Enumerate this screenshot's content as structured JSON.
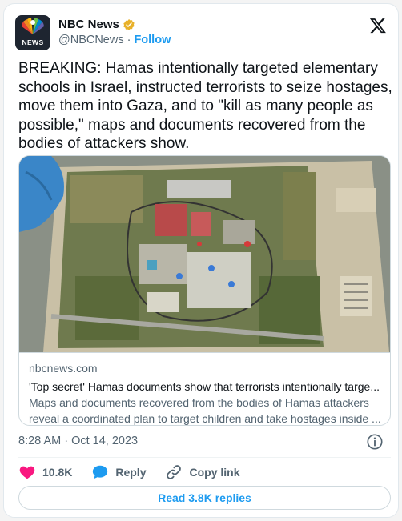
{
  "author": {
    "name": "NBC News",
    "handle": "@NBCNews",
    "separator": "·",
    "follow_label": "Follow",
    "avatar_text": "NEWS",
    "verified_badge_color": "#e8b12a"
  },
  "tweet": {
    "text": "BREAKING: Hamas intentionally targeted elementary schools in Israel, instructed terrorists to seize hostages, move them into Gaza, and to \"kill as many people as possible,\" maps and documents recovered from the bodies of attackers show.",
    "timestamp": "8:28 AM · Oct 14, 2023"
  },
  "link_card": {
    "domain": "nbcnews.com",
    "title": "'Top secret' Hamas documents show that terrorists intentionally targe...",
    "description_line1": "Maps and documents recovered from the bodies of Hamas attackers",
    "description_line2": "reveal a coordinated plan to target children and take hostages inside ...",
    "image_alt": "aerial map photo"
  },
  "actions": {
    "like_count": "10.8K",
    "reply_label": "Reply",
    "copy_link_label": "Copy link",
    "read_replies_label": "Read 3.8K replies"
  },
  "colors": {
    "accent": "#1d9bf0",
    "like": "#f91880",
    "text": "#0f1419",
    "muted": "#536471"
  },
  "icons": [
    "nbc-peacock-icon",
    "verified-badge-icon",
    "x-logo-icon",
    "info-icon",
    "heart-icon",
    "reply-icon",
    "link-icon"
  ]
}
